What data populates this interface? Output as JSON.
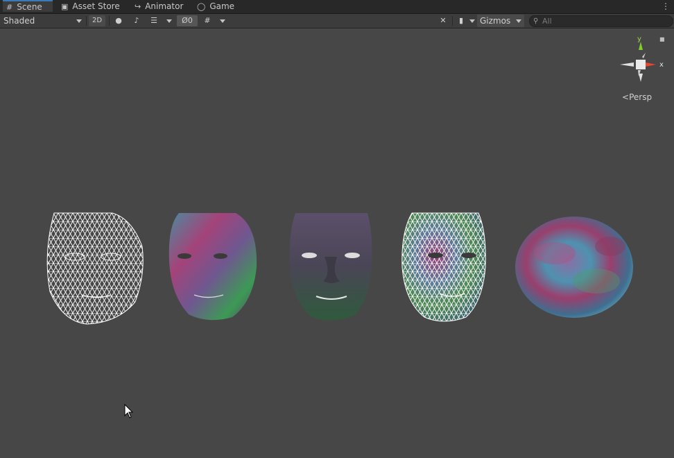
{
  "tabs": [
    {
      "label": "Scene",
      "icon": "grid-icon",
      "active": true
    },
    {
      "label": "Asset Store",
      "icon": "shopping-bag-icon",
      "active": false
    },
    {
      "label": "Animator",
      "icon": "animator-icon",
      "active": false
    },
    {
      "label": "Game",
      "icon": "gamepad-icon",
      "active": false
    }
  ],
  "toolbar": {
    "shading_mode": "Shaded",
    "mode_2d": "2D",
    "hidden_count": "0",
    "gizmos_label": "Gizmos",
    "search_placeholder": "All"
  },
  "gizmo": {
    "y_label": "y",
    "x_label": "x",
    "projection": "Persp",
    "colors": {
      "y": "#7fcf2a",
      "x": "#e8462f",
      "neutral": "#e6e6e6"
    }
  },
  "scene": {
    "objects": [
      {
        "name": "face-mesh-wireframe",
        "render": "wireframe"
      },
      {
        "name": "face-mesh-noise-textured",
        "render": "textured"
      },
      {
        "name": "face-mesh-shaded-textured",
        "render": "shaded"
      },
      {
        "name": "face-mesh-wireframe-textured",
        "render": "wireframe+textured"
      },
      {
        "name": "sphere-noise-textured",
        "render": "textured"
      }
    ]
  },
  "colors": {
    "viewport_bg": "#474747",
    "tab_accent": "#3a79bb"
  }
}
